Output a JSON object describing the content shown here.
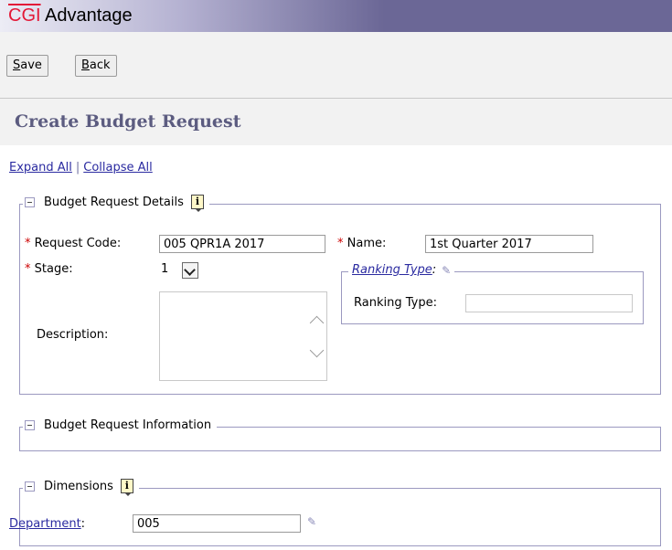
{
  "header": {
    "logo_brand": "CGI",
    "logo_product": "Advantage"
  },
  "toolbar": {
    "save_label": "Save",
    "save_mnemonic": "S",
    "save_rest": "ave",
    "back_label": "Back",
    "back_mnemonic": "B",
    "back_rest": "ack"
  },
  "page": {
    "title": "Create Budget Request"
  },
  "links": {
    "expand_all": "Expand All",
    "separator": "|",
    "collapse_all": "Collapse All"
  },
  "details": {
    "legend": "Budget Request Details",
    "required_mark": "*",
    "request_code_label": "Request Code:",
    "request_code_value": "005 QPR1A 2017",
    "name_label": "Name:",
    "name_value": "1st Quarter 2017",
    "stage_label": "Stage:",
    "stage_value": "1",
    "description_label": "Description:",
    "ranking_legend_link": "Ranking Type",
    "ranking_legend_colon": ":",
    "ranking_type_label": "Ranking Type:",
    "ranking_type_value": ""
  },
  "information": {
    "legend": "Budget Request Information"
  },
  "dimensions": {
    "legend": "Dimensions",
    "department_link": "Department",
    "department_colon": ":",
    "department_value": "005"
  },
  "icons": {
    "info": "info-icon",
    "pencil": "pencil-icon",
    "collapse": "collapse-icon"
  },
  "colors": {
    "header": "#6b6796",
    "accent_red": "#e31937",
    "link": "#2a2aa0",
    "title": "#5c5c80",
    "border": "#9b99c0"
  }
}
